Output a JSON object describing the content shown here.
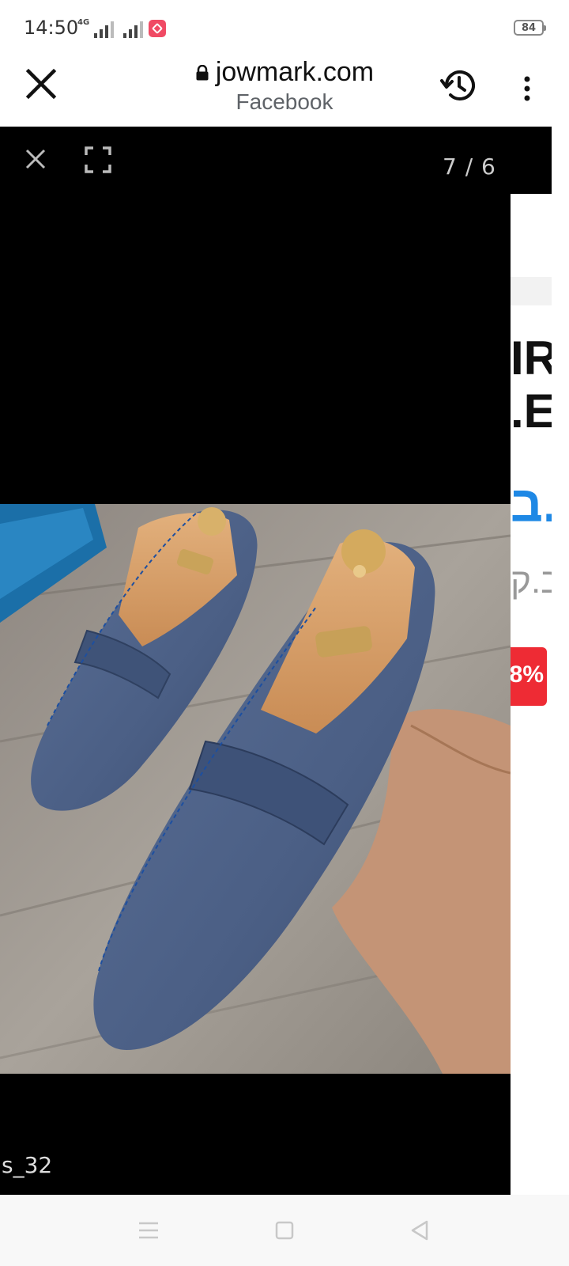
{
  "status_bar": {
    "time": "14:50",
    "network_type": "4G",
    "battery_level": "84",
    "notification_icon": "app-notification-icon"
  },
  "browser": {
    "url": "jowmark.com",
    "subtitle": "Facebook",
    "close_icon": "close-icon",
    "history_icon": "history-icon",
    "menu_icon": "more-vert-icon",
    "lock_icon": "lock-icon"
  },
  "lightbox": {
    "counter": "7 / 6",
    "caption": "s_32",
    "close_icon": "close-icon",
    "fullscreen_icon": "fullscreen-icon"
  },
  "background_page": {
    "heading_line1_fragment": "IR",
    "heading_line2_fragment": ".E",
    "blue_text_fragment": "ב.",
    "gray_text_fragment": "ב.ק",
    "discount_fragment": "8%"
  },
  "nav_bar": {
    "icons": [
      "menu-icon",
      "home-icon",
      "back-icon"
    ]
  },
  "colors": {
    "accent_blue": "#1e88e5",
    "discount_red": "#ee2b34",
    "lightbox_bg": "#000000"
  }
}
